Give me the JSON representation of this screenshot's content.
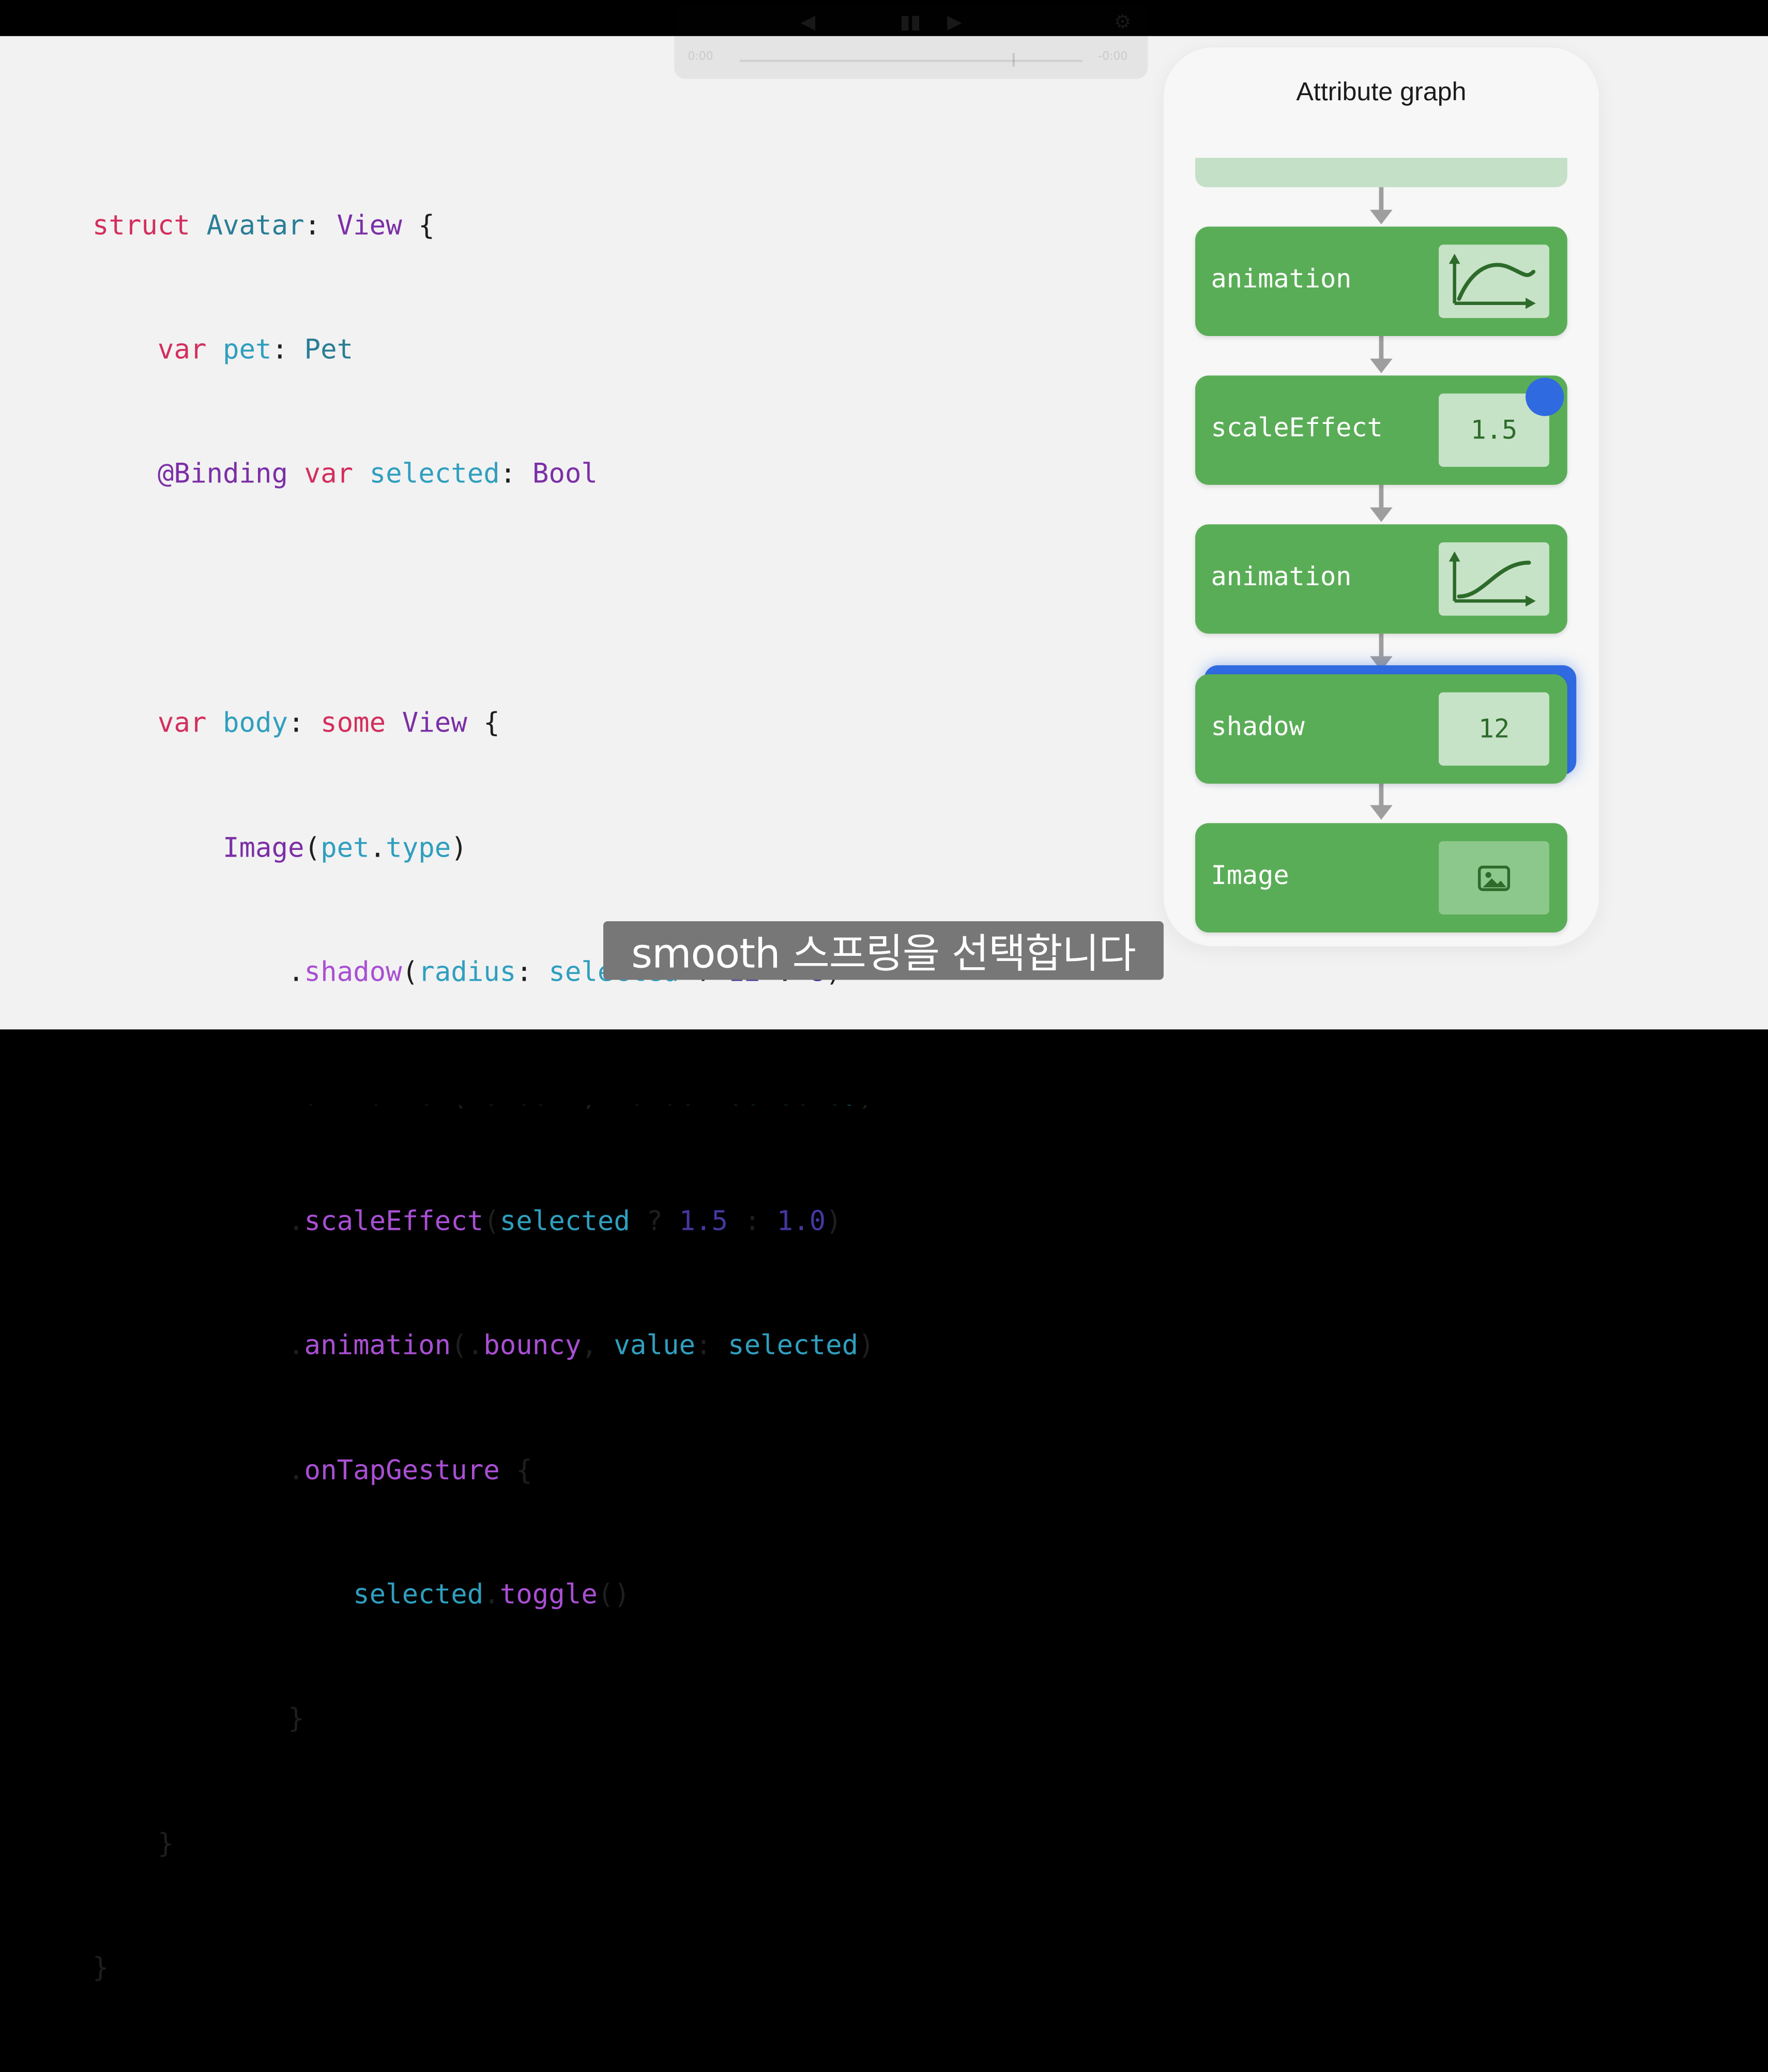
{
  "code": {
    "line1": {
      "kw": "struct",
      "name": "Avatar",
      "colon": ": ",
      "type": "View",
      "brace": " {"
    },
    "line2": {
      "kw": "var",
      "name": "pet",
      "colon": ": ",
      "type": "Pet"
    },
    "line3": {
      "attr": "@Binding",
      "kw": "var",
      "name": "selected",
      "colon": ": ",
      "type": "Bool"
    },
    "line5": {
      "kw": "var",
      "name": "body",
      "colon": ": ",
      "kw2": "some",
      "type": "View",
      "brace": " {"
    },
    "line6": {
      "fn": "Image",
      "open": "(",
      "a": "pet",
      "dot": ".",
      "b": "type",
      "close": ")"
    },
    "line7": {
      "dot": ".",
      "fn": "shadow",
      "open": "(",
      "label": "radius",
      "colon": ": ",
      "cond": "selected",
      "q": " ? ",
      "n1": "12",
      "c": " : ",
      "n2": "8",
      "close": ")"
    },
    "line8": {
      "dot": ".",
      "fn": "animation",
      "open": "(",
      "dot2": ".",
      "anim": "smooth",
      "comma": ", ",
      "label": "value",
      "colon": ": ",
      "arg": "selected",
      "close": ")"
    },
    "line9": {
      "dot": ".",
      "fn": "scaleEffect",
      "open": "(",
      "cond": "selected",
      "q": " ? ",
      "n1": "1.5",
      "c": " : ",
      "n2": "1.0",
      "close": ")"
    },
    "line10": {
      "dot": ".",
      "fn": "animation",
      "open": "(",
      "dot2": ".",
      "anim": "bouncy",
      "comma": ", ",
      "label": "value",
      "colon": ": ",
      "arg": "selected",
      "close": ")"
    },
    "line11": {
      "dot": ".",
      "fn": "onTapGesture",
      "brace": " {"
    },
    "line12": {
      "name": "selected",
      "dot": ".",
      "fn": "toggle",
      "parens": "()"
    },
    "close_brace": "}"
  },
  "graph": {
    "title": "Attribute graph",
    "nodes": [
      {
        "label": "animation",
        "icon": "smooth-curve-graph-icon"
      },
      {
        "label": "scaleEffect",
        "value": "1.5"
      },
      {
        "label": "animation",
        "icon": "ease-curve-graph-icon"
      },
      {
        "label": "shadow",
        "value": "12"
      },
      {
        "label": "Image",
        "icon": "photo-icon"
      }
    ],
    "colors": {
      "node": "#5aad57",
      "box": "#c7e3c7",
      "highlight": "#2f6ae0",
      "arrow": "#9e9e9e"
    }
  },
  "caption": "smooth 스프링을 선택합니다",
  "player": {
    "controls": [
      "◀",
      "▮▮",
      "▶",
      "⚙"
    ],
    "time_elapsed": "0:00",
    "time_remaining": "-0:00"
  }
}
